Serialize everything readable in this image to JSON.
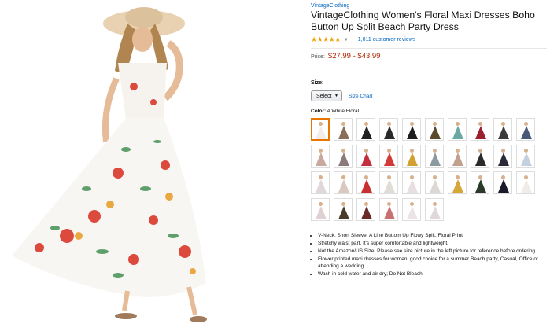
{
  "product": {
    "brand": "VintageClothing",
    "title": "VintageClothing Women's Floral Maxi Dresses Boho Button Up Split Beach Party Dress",
    "rating_stars": "★★★★★",
    "reviews": "1,011 customer reviews",
    "price_label": "Price:",
    "price": "$27.99 - $43.99",
    "size_label": "Size:",
    "size_select": "Select",
    "size_chart": "Size Chart",
    "color_label": "Color:",
    "color_value": "A White Floral",
    "swatches": [
      {
        "color": "#f2ede6"
      },
      {
        "color": "#8b6e5a"
      },
      {
        "color": "#222222"
      },
      {
        "color": "#2a2a2a"
      },
      {
        "color": "#1e1e1e"
      },
      {
        "color": "#5a4a2a"
      },
      {
        "color": "#6aa9a2"
      },
      {
        "color": "#9a2030"
      },
      {
        "color": "#3a3a3a"
      },
      {
        "color": "#4a5878"
      },
      {
        "color": "#c9a8a0"
      },
      {
        "color": "#8a7a7a"
      },
      {
        "color": "#c23040"
      },
      {
        "color": "#d23a3a"
      },
      {
        "color": "#d2a030"
      },
      {
        "color": "#8a9aa0"
      },
      {
        "color": "#c2a090"
      },
      {
        "color": "#2a2a2a"
      },
      {
        "color": "#2a2a38"
      },
      {
        "color": "#c2d0e0"
      },
      {
        "color": "#e0d8d8"
      },
      {
        "color": "#d8c8c0"
      },
      {
        "color": "#c83030"
      },
      {
        "color": "#e0dcd8"
      },
      {
        "color": "#e8e0e0"
      },
      {
        "color": "#dcd8d4"
      },
      {
        "color": "#d4a838"
      },
      {
        "color": "#2a3a2a"
      },
      {
        "color": "#1a1a2a"
      },
      {
        "color": "#f0ece8"
      },
      {
        "color": "#e0d0d0"
      },
      {
        "color": "#4a3a2a"
      },
      {
        "color": "#6a2a2a"
      },
      {
        "color": "#c87070"
      },
      {
        "color": "#ece4e4"
      },
      {
        "color": "#e0d8d8"
      }
    ],
    "bullets": [
      "V-Neck, Short Sleeve, A Line Buttom Up Flowy Split, Floral Print",
      "Stretchy waist part, It's super comfortable and lightweight.",
      "Not the Amazon/US Size, Please see size picture in the left picture for reference before ordering.",
      "Flower printed maxi dresses for women, good choice for a summer Beach party, Casual, Office or attending a wedding.",
      "Wash in cold water and air dry; Do Not Bleach"
    ]
  },
  "colors": {
    "link": "#0066c0",
    "price": "#b12704",
    "star": "#f0a000",
    "selected": "#e77600"
  }
}
